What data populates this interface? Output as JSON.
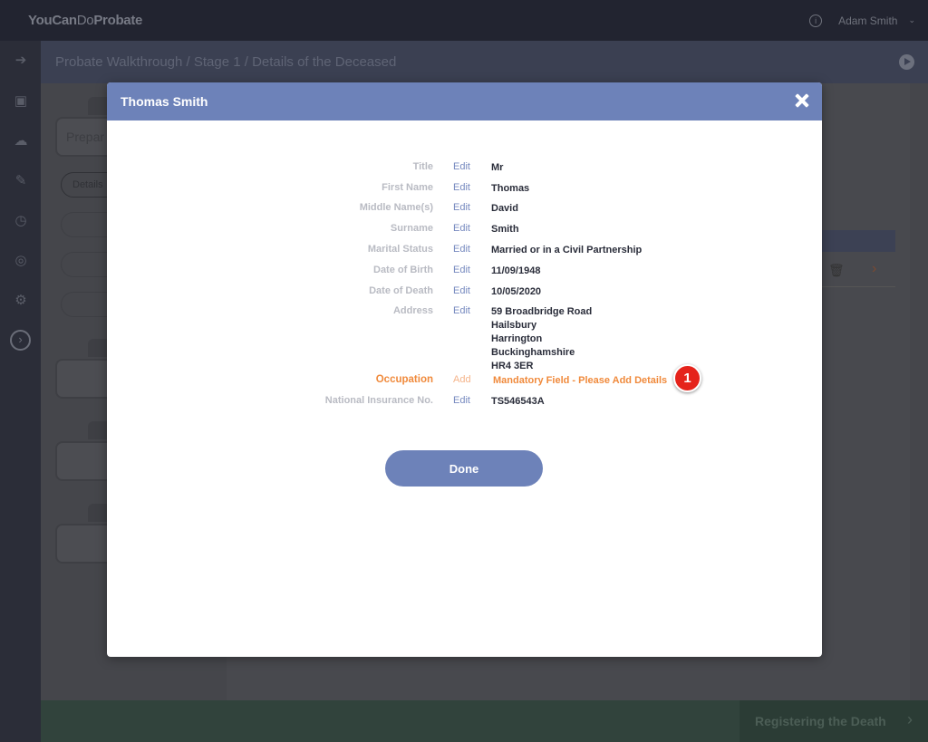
{
  "app": {
    "logo_part1": "YouCan",
    "logo_part2": "Do",
    "logo_part3": "Probate",
    "user_name": "Adam Smith"
  },
  "breadcrumb": "Probate Walkthrough / Stage 1 / Details of the Deceased",
  "background": {
    "left_box_label": "Prepar",
    "details_pill": "Details",
    "footer_next_label": "Registering the Death"
  },
  "modal": {
    "title": "Thomas Smith",
    "done_label": "Done",
    "rows": [
      {
        "label": "Title",
        "action": "Edit",
        "value": "Mr"
      },
      {
        "label": "First Name",
        "action": "Edit",
        "value": "Thomas"
      },
      {
        "label": "Middle Name(s)",
        "action": "Edit",
        "value": "David"
      },
      {
        "label": "Surname",
        "action": "Edit",
        "value": "Smith"
      },
      {
        "label": "Marital Status",
        "action": "Edit",
        "value": "Married or in a Civil Partnership"
      },
      {
        "label": "Date of Birth",
        "action": "Edit",
        "value": "11/09/1948"
      },
      {
        "label": "Date of Death",
        "action": "Edit",
        "value": "10/05/2020"
      },
      {
        "label": "Address",
        "action": "Edit",
        "value_lines": [
          "59 Broadbridge Road",
          "Hailsbury",
          "Harrington",
          "Buckinghamshire",
          "HR4 3ER"
        ]
      },
      {
        "label": "Occupation",
        "action": "Add",
        "value": "Mandatory Field - Please Add Details",
        "badge": "1"
      },
      {
        "label": "National Insurance No.",
        "action": "Edit",
        "value": "TS546543A"
      }
    ]
  },
  "colors": {
    "accent": "#6d82b9",
    "warning": "#f08a3c",
    "badge": "#e5231b"
  }
}
